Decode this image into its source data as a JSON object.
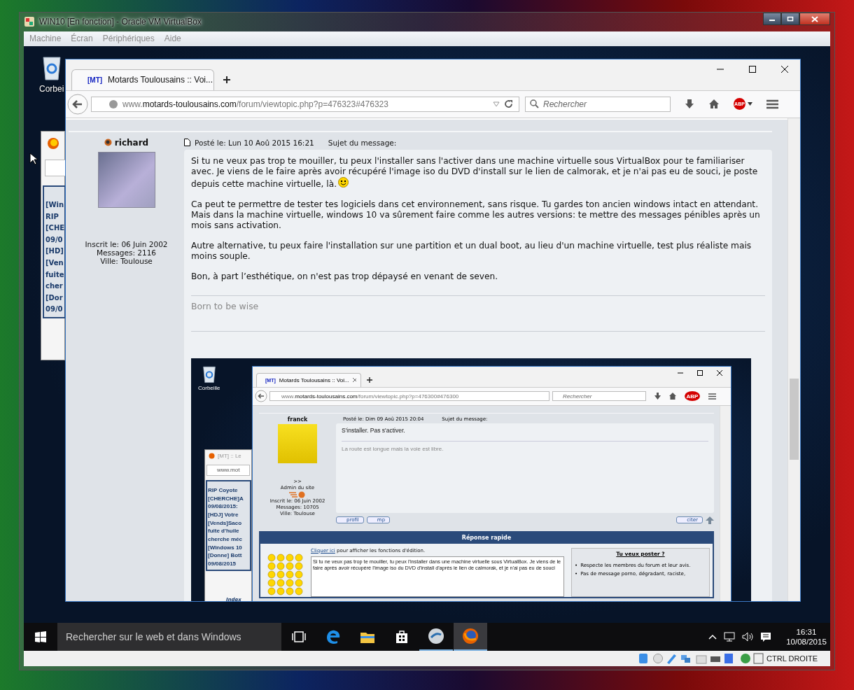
{
  "vm_window": {
    "title": "WIN10 [En fonction] - Oracle VM VirtualBox",
    "menu": [
      {
        "label": "Machine",
        "disabled": true
      },
      {
        "label": "Écran",
        "disabled": true
      },
      {
        "label": "Périphériques",
        "disabled": true
      },
      {
        "label": "Aide",
        "disabled": true
      }
    ]
  },
  "desktop": {
    "recycle_bin_label": "Corbei",
    "background_window": {
      "list": [
        "[Win",
        "RIP",
        "[CHE",
        "09/0",
        "[HD]",
        "[Ven",
        "fuite",
        "cher",
        "[Dor",
        "09/0"
      ]
    }
  },
  "browser": {
    "tab": {
      "logo": "[MT]",
      "title": "Motards Toulousains :: Voi..."
    },
    "url": {
      "prefix": "www.",
      "domain": "motards-toulousains.com",
      "path": "/forum/viewtopic.php?p=476323#476323"
    },
    "search": {
      "placeholder": "Rechercher"
    },
    "adblock_label": "ABP"
  },
  "post": {
    "author": "richard",
    "posted": "Posté le: Lun 10 Aoû 2015 16:21",
    "subject_label": "Sujet du message:",
    "profile": [
      "Inscrit le: 06 Juin 2002",
      "Messages: 2116",
      "Ville: Toulouse"
    ],
    "paragraphs": [
      "Si tu ne veux pas trop te mouiller, tu peux l'installer sans l'activer dans une machine virtuelle sous VirtualBox pour te familiariser avec. Je viens de le faire après avoir récupéré l'image iso du DVD d'install sur le lien de calmorak, et je n'ai pas eu de souci, je poste depuis cette machine virtuelle, là.",
      "Ca peut te permettre de tester tes logiciels dans cet environnement, sans risque. Tu gardes ton ancien windows intact en attendant. Mais dans la machine virtuelle, windows 10 va sûrement faire comme les autres versions: te mettre des messages pénibles après un mois sans activation.",
      "Autre alternative, tu peux faire l'installation sur une partition et un dual boot, au lieu d'un machine virtuelle, test plus réaliste mais moins souple.",
      "Bon, à part l’esthétique, on n'est pas trop dépaysé en venant de seven."
    ],
    "signature": "Born to be wise"
  },
  "embedded_screenshot": {
    "recycle_bin_label": "Corbeille",
    "background_window": {
      "tab": "[MT] :: Le",
      "url": "www.mot",
      "list": [
        "RIP Coyote",
        "[CHERCHE]A",
        "09/08/2015:",
        "[HDJ] Votre",
        "[Vends]Saco",
        "fuite d'huile",
        "cherche méc",
        "[Windows 10",
        "[Donne] Bott",
        "09/08/2015"
      ],
      "footer": "Index"
    },
    "browser": {
      "tab": {
        "logo": "[MT]",
        "title": "Motards Toulousains :: Voi..."
      },
      "url": {
        "prefix": "www.",
        "domain": "motards-toulousains.com",
        "path": "/forum/viewtopic.php?p=476300#476300"
      },
      "search": {
        "placeholder": "Rechercher"
      },
      "adblock_label": "ABP"
    },
    "post": {
      "author": "franck",
      "posted": "Posté le: Dim 09 Aoû 2015 20:04",
      "subject_label": "Sujet du message:",
      "rank": [
        ">>",
        "Admin du site"
      ],
      "profile": [
        "Inscrit le: 06 Juin 2002",
        "Messages: 10705",
        "Ville: Toulouse"
      ],
      "message": "S'installer. Pas s'activer.",
      "signature": "La route est longue mais la voie est libre.",
      "buttons": [
        "profil",
        "mp"
      ],
      "quote_button": "citer"
    },
    "quick_reply": {
      "title": "Réponse rapide",
      "edit_link": "Cliquer ici",
      "edit_hint": "pour afficher les fonctions d'édition.",
      "draft": "Si tu ne veux pas trop te mouiller, tu peux l'installer dans une machine virtuelle sous VirtualBox. Je viens de le faire après avoir récupéré l'image iso du DVD d'install d'après le lien de calmorak, et je n'ai pas eu de souci",
      "rules_title": "Tu veux poster ?",
      "bullet": "•",
      "rules": [
        "Respecte les membres du forum et leur avis.",
        "Pas de message porno, dégradant, raciste,"
      ]
    }
  },
  "taskbar": {
    "search": {
      "placeholder": "Rechercher sur le web et dans Windows"
    },
    "apps": [
      {
        "kind": "taskview",
        "running": false,
        "selected": false
      },
      {
        "kind": "edge",
        "running": false,
        "selected": false
      },
      {
        "kind": "explorer",
        "running": false,
        "selected": false
      },
      {
        "kind": "store",
        "running": false,
        "selected": false
      },
      {
        "kind": "vbox",
        "running": true,
        "selected": false
      },
      {
        "kind": "firefox",
        "running": true,
        "selected": true
      }
    ],
    "time": "16:31",
    "date": "10/08/2015"
  },
  "status_bar": {
    "host_key": "CTRL DROITE"
  }
}
